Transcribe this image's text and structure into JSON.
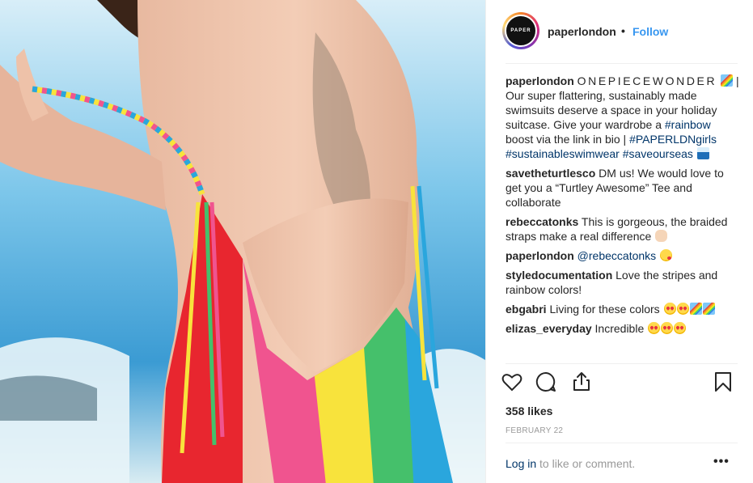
{
  "post": {
    "username": "paperlondon",
    "avatar_text": "PAPER",
    "follow_label": "Follow",
    "separator": "•"
  },
  "caption": {
    "username": "paperlondon",
    "title": "ONEPIECEWONDER",
    "text1": " | Our super flattering, sustainably made swimsuits deserve a space in your holiday suitcase. Give your wardrobe a ",
    "tag1": "#rainbow",
    "text2": " boost via the link in bio | ",
    "tag2": "#PAPERLDNgirls",
    "text3": " ",
    "tag3": "#sustainableswimwear",
    "text4": " ",
    "tag4": "#saveourseas"
  },
  "comments": [
    {
      "user": "savetheturtlesco",
      "text": " DM us! We would love to get you a “Turtley Awesome” Tee and collaborate"
    },
    {
      "user": "rebeccatonks",
      "text": " This is gorgeous, the braided straps make a real difference "
    },
    {
      "user": "paperlondon",
      "mention": "@rebeccatonks",
      "text": " "
    },
    {
      "user": "styledocumentation",
      "text": " Love the stripes and rainbow colors!"
    },
    {
      "user": "ebgabri",
      "text": " Living for these colors "
    },
    {
      "user": "elizas_everyday",
      "text": " Incredible "
    }
  ],
  "icons": [
    "heart-icon",
    "comment-icon",
    "share-icon",
    "bookmark-icon",
    "more-icon"
  ],
  "likes": "358 likes",
  "date": "FEBRUARY 22",
  "login": {
    "link": "Log in",
    "text": " to like or comment."
  },
  "more_label": "•••",
  "colors": {
    "link": "#003569",
    "follow": "#3897f0",
    "muted": "#999999",
    "text": "#262626"
  }
}
